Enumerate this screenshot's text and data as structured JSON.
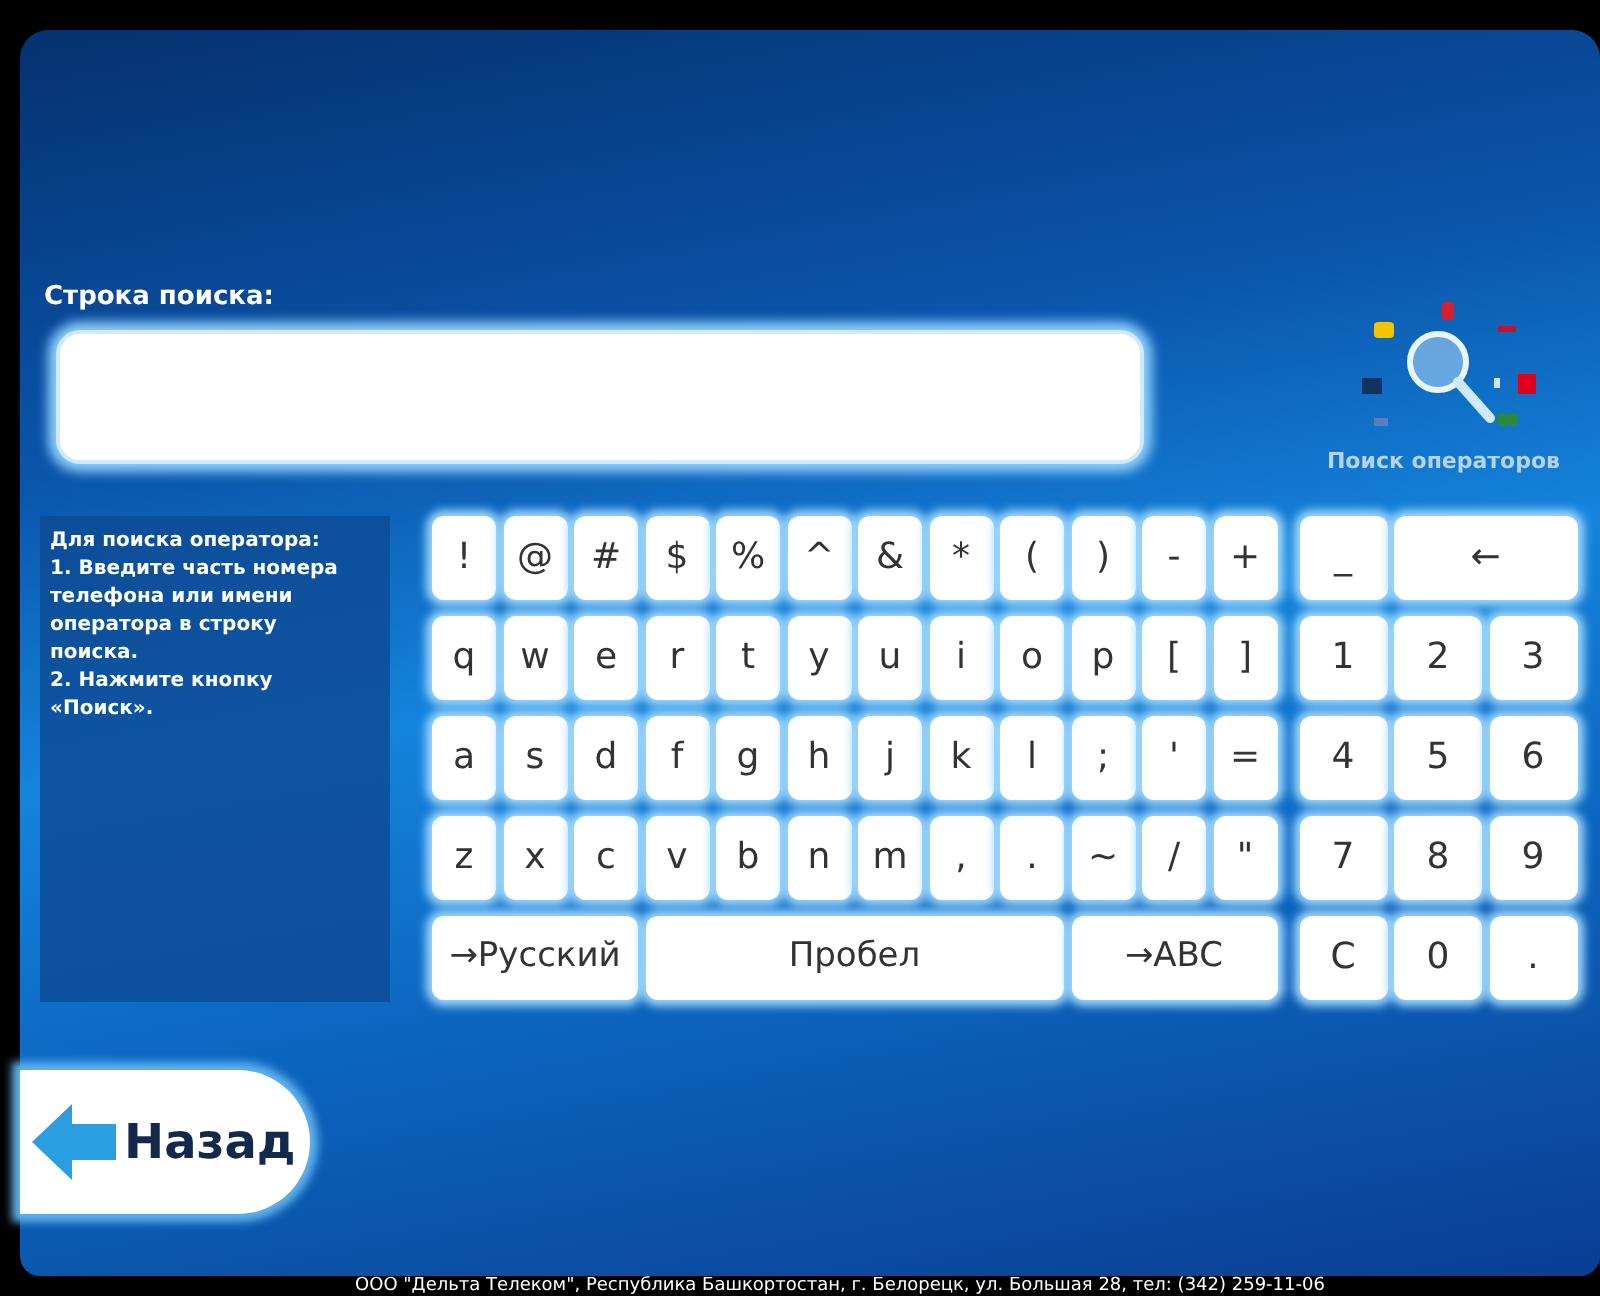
{
  "search": {
    "label": "Строка поиска:"
  },
  "operator_search": {
    "label": "Поиск операторов"
  },
  "instructions": [
    "Для поиска оператора:",
    "1. Введите часть номера телефона или имени оператора в строку поиска.",
    "2. Нажмите кнопку «Поиск»."
  ],
  "keyboard": {
    "rows": [
      {
        "keys": [
          {
            "label": "!",
            "kind": "key"
          },
          {
            "label": "@",
            "kind": "key"
          },
          {
            "label": "#",
            "kind": "key"
          },
          {
            "label": "$",
            "kind": "key"
          },
          {
            "label": "%",
            "kind": "key"
          },
          {
            "label": "^",
            "kind": "key"
          },
          {
            "label": "&",
            "kind": "key"
          },
          {
            "label": "*",
            "kind": "key"
          },
          {
            "label": "(",
            "kind": "key"
          },
          {
            "label": ")",
            "kind": "key"
          },
          {
            "label": "-",
            "kind": "key"
          },
          {
            "label": "+",
            "kind": "key"
          },
          {
            "label": "_",
            "kind": "side"
          },
          {
            "label": "←",
            "kind": "backspace"
          }
        ]
      },
      {
        "keys": [
          {
            "label": "q",
            "kind": "key"
          },
          {
            "label": "w",
            "kind": "key"
          },
          {
            "label": "e",
            "kind": "key"
          },
          {
            "label": "r",
            "kind": "key"
          },
          {
            "label": "t",
            "kind": "key"
          },
          {
            "label": "y",
            "kind": "key"
          },
          {
            "label": "u",
            "kind": "key"
          },
          {
            "label": "i",
            "kind": "key"
          },
          {
            "label": "o",
            "kind": "key"
          },
          {
            "label": "p",
            "kind": "key"
          },
          {
            "label": "[",
            "kind": "key"
          },
          {
            "label": "]",
            "kind": "key"
          },
          {
            "label": "1",
            "kind": "side"
          },
          {
            "label": "2",
            "kind": "key"
          },
          {
            "label": "3",
            "kind": "key"
          }
        ]
      },
      {
        "keys": [
          {
            "label": "a",
            "kind": "key"
          },
          {
            "label": "s",
            "kind": "key"
          },
          {
            "label": "d",
            "kind": "key"
          },
          {
            "label": "f",
            "kind": "key"
          },
          {
            "label": "g",
            "kind": "key"
          },
          {
            "label": "h",
            "kind": "key"
          },
          {
            "label": "j",
            "kind": "key"
          },
          {
            "label": "k",
            "kind": "key"
          },
          {
            "label": "l",
            "kind": "key"
          },
          {
            "label": ";",
            "kind": "key"
          },
          {
            "label": "'",
            "kind": "key"
          },
          {
            "label": "=",
            "kind": "key"
          },
          {
            "label": "4",
            "kind": "side"
          },
          {
            "label": "5",
            "kind": "key"
          },
          {
            "label": "6",
            "kind": "key"
          }
        ]
      },
      {
        "keys": [
          {
            "label": "z",
            "kind": "key"
          },
          {
            "label": "x",
            "kind": "key"
          },
          {
            "label": "c",
            "kind": "key"
          },
          {
            "label": "v",
            "kind": "key"
          },
          {
            "label": "b",
            "kind": "key"
          },
          {
            "label": "n",
            "kind": "key"
          },
          {
            "label": "m",
            "kind": "key"
          },
          {
            "label": ",",
            "kind": "key"
          },
          {
            "label": ".",
            "kind": "key"
          },
          {
            "label": "~",
            "kind": "key"
          },
          {
            "label": "/",
            "kind": "key"
          },
          {
            "label": "\"",
            "kind": "key"
          },
          {
            "label": "7",
            "kind": "side"
          },
          {
            "label": "8",
            "kind": "key"
          },
          {
            "label": "9",
            "kind": "key"
          }
        ]
      },
      {
        "keys": [
          {
            "label": "→Русский",
            "kind": "language"
          },
          {
            "label": "Пробел",
            "kind": "space"
          },
          {
            "label": "→ABC",
            "kind": "language"
          },
          {
            "label": "C",
            "kind": "side"
          },
          {
            "label": "0",
            "kind": "key"
          },
          {
            "label": ".",
            "kind": "key"
          }
        ]
      }
    ]
  },
  "back_button": {
    "label": "Назад"
  },
  "footer": "ООО \"Дельта Телеком\", Республика Башкортостан, г. Белорецк, ул. Большая 28, тел: (342) 259-11-06"
}
